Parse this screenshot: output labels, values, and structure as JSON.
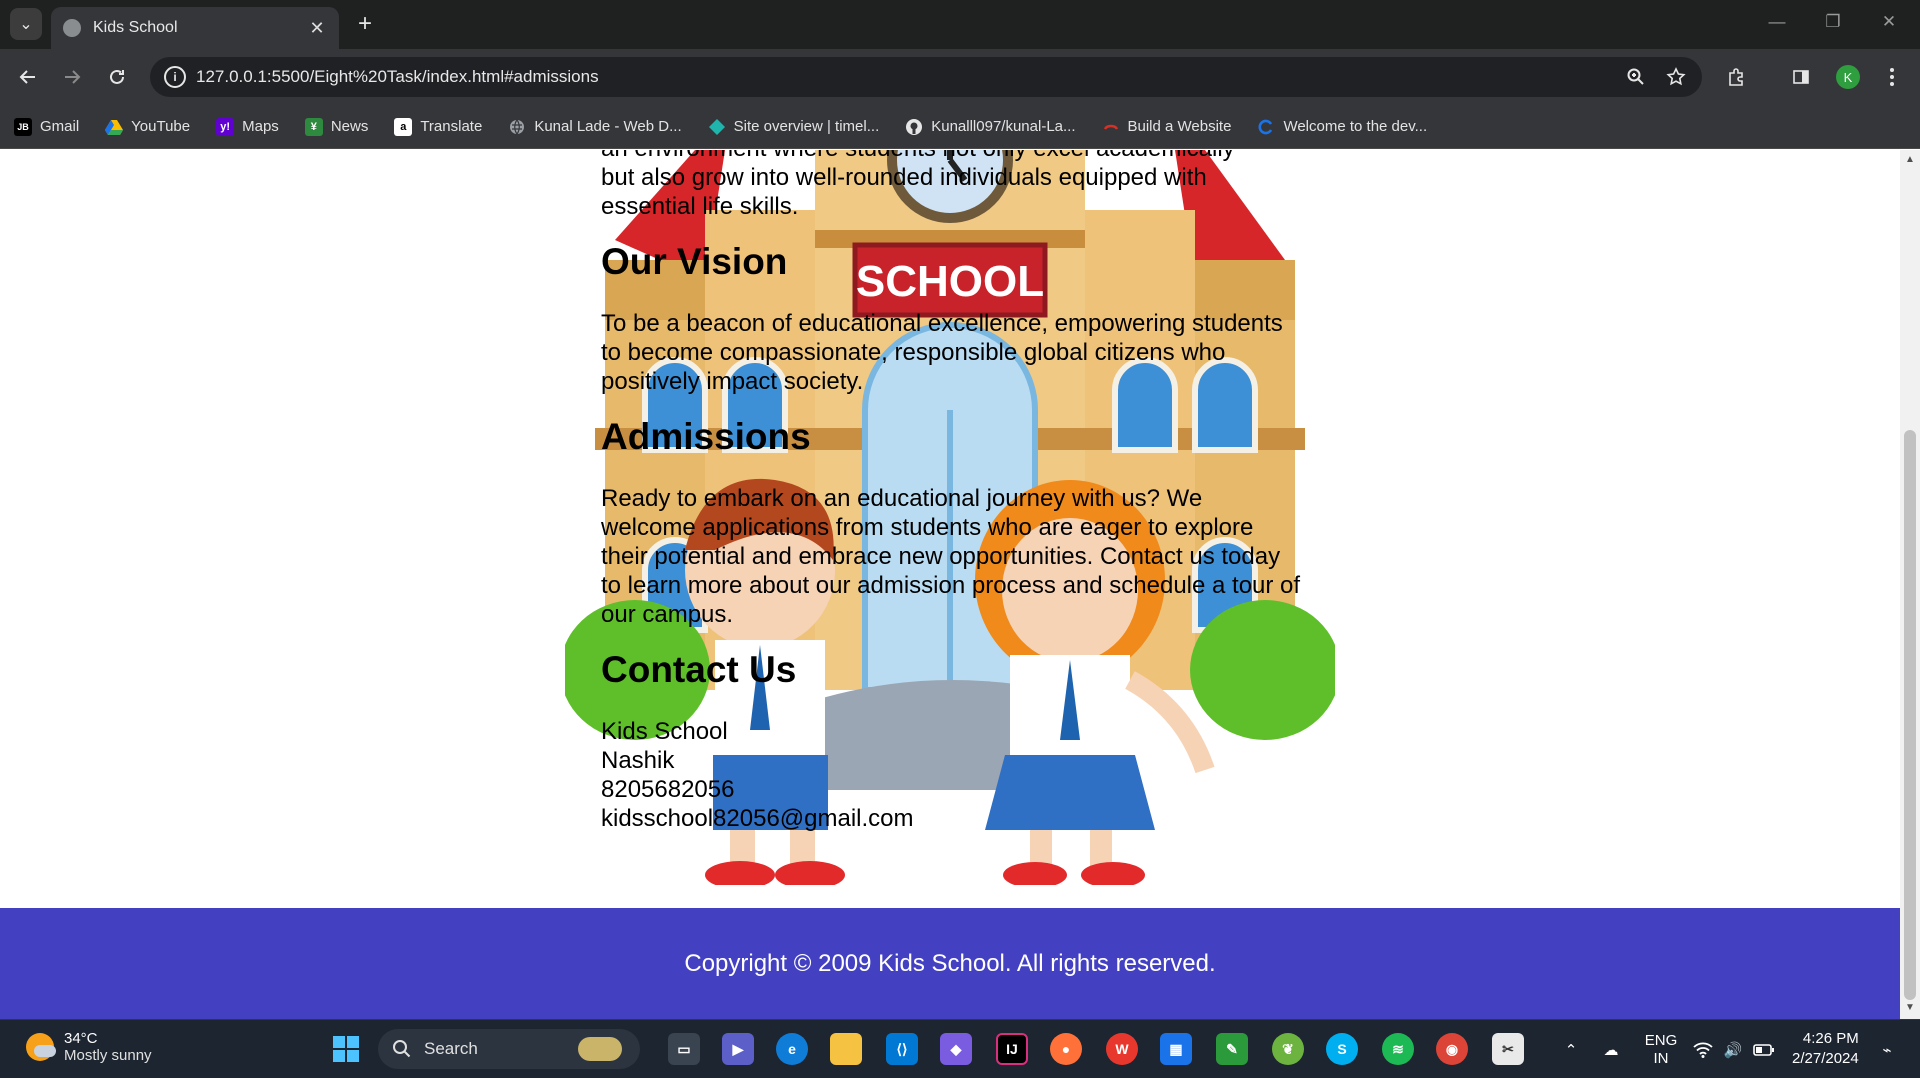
{
  "browser": {
    "tab_title": "Kids School",
    "url": "127.0.0.1:5500/Eight%20Task/index.html#admissions",
    "profile_initial": "K"
  },
  "bookmarks": [
    {
      "label": "Gmail",
      "icon": "jetbrains-icon"
    },
    {
      "label": "YouTube",
      "icon": "drive-icon"
    },
    {
      "label": "Maps",
      "icon": "yahoo-icon"
    },
    {
      "label": "News",
      "icon": "news-icon"
    },
    {
      "label": "Translate",
      "icon": "amazon-icon"
    },
    {
      "label": "Kunal Lade - Web D...",
      "icon": "globe-icon"
    },
    {
      "label": "Site overview | timel...",
      "icon": "diamond-icon"
    },
    {
      "label": "Kunalll097/kunal-La...",
      "icon": "github-icon"
    },
    {
      "label": "Build a Website",
      "icon": "link-icon"
    },
    {
      "label": "Welcome to the dev...",
      "icon": "dev-icon"
    }
  ],
  "page": {
    "intro_partial_line": "an environment where students not only excel academically",
    "intro_text": "but also grow into well-rounded individuals equipped with essential life skills.",
    "vision_heading": "Our Vision",
    "vision_text": "To be a beacon of educational excellence, empowering students to become compassionate, responsible global citizens who positively impact society.",
    "admissions_heading": "Admissions",
    "admissions_text": "Ready to embark on an educational journey with us? We welcome applications from students who are eager to explore their potential and embrace new opportunities. Contact us today to learn more about our admission process and schedule a tour of our campus.",
    "contact_heading": "Contact Us",
    "contact_lines": [
      "Kids School",
      "Nashik",
      "8205682056",
      "kidsschool82056@gmail.com"
    ],
    "footer_text": "Copyright © 2009 Kids School. All rights reserved.",
    "school_sign": "SCHOOL",
    "colors": {
      "footer": "#4340c2"
    }
  },
  "taskbar": {
    "temperature": "34°C",
    "weather": "Mostly sunny",
    "search_label": "Search",
    "language": "ENG",
    "region": "IN",
    "time": "4:26 PM",
    "date": "2/27/2024"
  }
}
